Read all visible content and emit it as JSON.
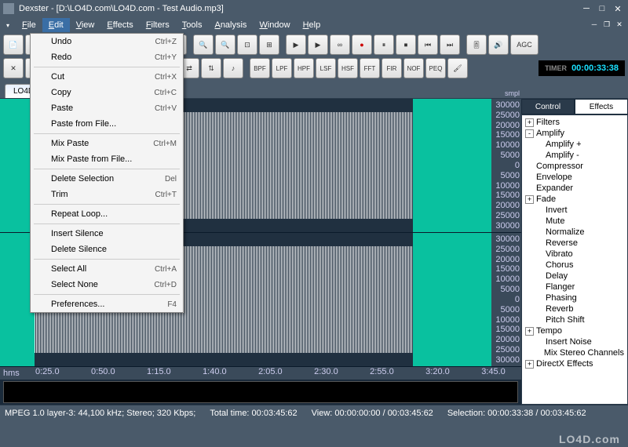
{
  "title": "Dexster - [D:\\LO4D.com\\LO4D.com - Test Audio.mp3]",
  "menu": [
    "File",
    "Edit",
    "View",
    "Effects",
    "Filters",
    "Tools",
    "Analysis",
    "Window",
    "Help"
  ],
  "active_menu_index": 1,
  "edit_menu": {
    "groups": [
      [
        {
          "label": "Undo",
          "shortcut": "Ctrl+Z"
        },
        {
          "label": "Redo",
          "shortcut": "Ctrl+Y"
        }
      ],
      [
        {
          "label": "Cut",
          "shortcut": "Ctrl+X"
        },
        {
          "label": "Copy",
          "shortcut": "Ctrl+C"
        },
        {
          "label": "Paste",
          "shortcut": "Ctrl+V"
        },
        {
          "label": "Paste from File...",
          "shortcut": ""
        }
      ],
      [
        {
          "label": "Mix Paste",
          "shortcut": "Ctrl+M"
        },
        {
          "label": "Mix Paste from File...",
          "shortcut": ""
        }
      ],
      [
        {
          "label": "Delete Selection",
          "shortcut": "Del"
        },
        {
          "label": "Trim",
          "shortcut": "Ctrl+T"
        }
      ],
      [
        {
          "label": "Repeat Loop...",
          "shortcut": ""
        }
      ],
      [
        {
          "label": "Insert Silence",
          "shortcut": ""
        },
        {
          "label": "Delete Silence",
          "shortcut": ""
        }
      ],
      [
        {
          "label": "Select All",
          "shortcut": "Ctrl+A"
        },
        {
          "label": "Select None",
          "shortcut": "Ctrl+D"
        }
      ],
      [
        {
          "label": "Preferences...",
          "shortcut": "F4"
        }
      ]
    ]
  },
  "toolbar1": {
    "icons": [
      "new",
      "open",
      "save",
      "cut",
      "copy",
      "paste",
      "undo",
      "redo",
      "zoom-in",
      "zoom-out",
      "zoom-fit",
      "zoom-sel",
      "play",
      "play-loop",
      "loop",
      "record",
      "pause",
      "stop",
      "skip-start",
      "skip-end",
      "mixer",
      "speaker"
    ],
    "agc": "AGC"
  },
  "toolbar2": {
    "icons": [
      "shuffle",
      "arrow-left",
      "stop2",
      "vol1",
      "brightness",
      "wave1",
      "wave2",
      "wave3",
      "arrows",
      "up-down",
      "note"
    ],
    "filters": [
      "BPF",
      "LPF",
      "HPF",
      "LSF",
      "HSF",
      "FFT",
      "FIR",
      "NOF",
      "PEQ"
    ],
    "paint": "paint",
    "timer_label": "TIMER",
    "timer_value": "00:00:33:38"
  },
  "tab": "LO4D...",
  "amp_label": "smpl",
  "amp_ticks": [
    "30000",
    "25000",
    "20000",
    "15000",
    "10000",
    "5000",
    "0",
    "5000",
    "10000",
    "15000",
    "20000",
    "25000",
    "30000"
  ],
  "time_label": "hms",
  "time_ticks": [
    "0:25.0",
    "0:50.0",
    "1:15.0",
    "1:40.0",
    "2:05.0",
    "2:30.0",
    "2:55.0",
    "3:20.0",
    "3:45.0"
  ],
  "sidepanel": {
    "tabs": [
      "Control",
      "Effects"
    ],
    "active_tab": 1,
    "tree": [
      {
        "label": "Filters",
        "depth": 0,
        "exp": "+"
      },
      {
        "label": "Amplify",
        "depth": 0,
        "exp": "-"
      },
      {
        "label": "Amplify +",
        "depth": 1,
        "exp": null
      },
      {
        "label": "Amplify -",
        "depth": 1,
        "exp": null
      },
      {
        "label": "Compressor",
        "depth": 0,
        "exp": null,
        "leaf": true
      },
      {
        "label": "Envelope",
        "depth": 0,
        "exp": null,
        "leaf": true
      },
      {
        "label": "Expander",
        "depth": 0,
        "exp": null,
        "leaf": true
      },
      {
        "label": "Fade",
        "depth": 0,
        "exp": "+"
      },
      {
        "label": "Invert",
        "depth": 0,
        "exp": null,
        "leaf": true,
        "d1": true
      },
      {
        "label": "Mute",
        "depth": 0,
        "exp": null,
        "leaf": true,
        "d1": true
      },
      {
        "label": "Normalize",
        "depth": 0,
        "exp": null,
        "leaf": true,
        "d1": true
      },
      {
        "label": "Reverse",
        "depth": 0,
        "exp": null,
        "leaf": true,
        "d1": true
      },
      {
        "label": "Vibrato",
        "depth": 0,
        "exp": null,
        "leaf": true,
        "d1": true
      },
      {
        "label": "Chorus",
        "depth": 0,
        "exp": null,
        "leaf": true,
        "d1": true
      },
      {
        "label": "Delay",
        "depth": 0,
        "exp": null,
        "leaf": true,
        "d1": true
      },
      {
        "label": "Flanger",
        "depth": 0,
        "exp": null,
        "leaf": true,
        "d1": true
      },
      {
        "label": "Phasing",
        "depth": 0,
        "exp": null,
        "leaf": true,
        "d1": true
      },
      {
        "label": "Reverb",
        "depth": 0,
        "exp": null,
        "leaf": true,
        "d1": true
      },
      {
        "label": "Pitch Shift",
        "depth": 0,
        "exp": null,
        "leaf": true,
        "d1": true
      },
      {
        "label": "Tempo",
        "depth": 0,
        "exp": "+"
      },
      {
        "label": "Insert Noise",
        "depth": 0,
        "exp": null,
        "leaf": true,
        "d1": true
      },
      {
        "label": "Mix Stereo Channels",
        "depth": 0,
        "exp": null,
        "leaf": true,
        "d1": true
      },
      {
        "label": "DirectX Effects",
        "depth": 0,
        "exp": "+"
      }
    ]
  },
  "statusbar": {
    "format": "MPEG 1.0 layer-3:  44,100 kHz;  Stereo;  320 Kbps;",
    "total": "Total time:  00:03:45:62",
    "view": "View:  00:00:00:00 / 00:03:45:62",
    "selection": "Selection:  00:00:33:38 / 00:03:45:62"
  },
  "watermark": "LO4D.com"
}
